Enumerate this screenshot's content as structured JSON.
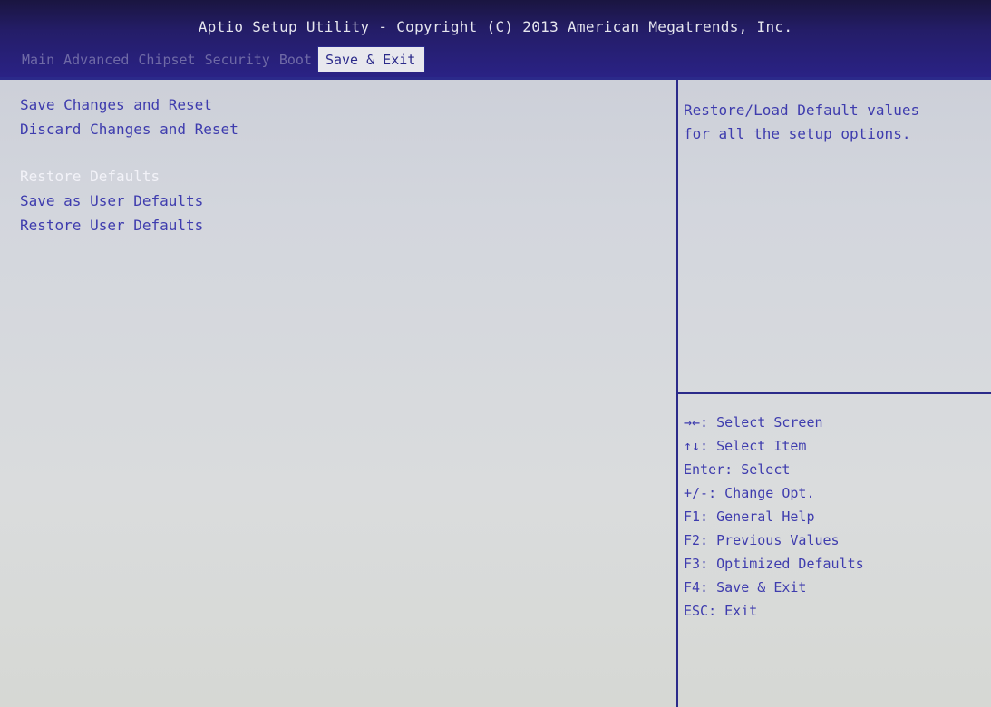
{
  "header": {
    "title": "Aptio Setup Utility - Copyright (C) 2013 American Megatrends, Inc.",
    "tabs": [
      {
        "label": "Main"
      },
      {
        "label": "Advanced"
      },
      {
        "label": "Chipset"
      },
      {
        "label": "Security"
      },
      {
        "label": "Boot"
      },
      {
        "label": "Save & Exit",
        "active": true
      }
    ]
  },
  "menu": {
    "items": [
      {
        "label": "Save Changes and Reset"
      },
      {
        "label": "Discard Changes and Reset"
      },
      {
        "label": "Restore Defaults",
        "selected": true
      },
      {
        "label": "Save as User Defaults"
      },
      {
        "label": "Restore User Defaults"
      }
    ]
  },
  "help": {
    "lines": [
      "Restore/Load Default values",
      "for all the setup options."
    ]
  },
  "keys": [
    "→←: Select Screen",
    "↑↓: Select Item",
    "Enter: Select",
    "+/-: Change Opt.",
    "F1: General Help",
    "F2: Previous Values",
    "F3: Optimized Defaults",
    "F4: Save & Exit",
    "ESC: Exit"
  ],
  "colors": {
    "accent": "#2b2a8a",
    "text": "#3e3cae",
    "selected_text": "#f2f2f8",
    "header_bg": "#241d68"
  }
}
